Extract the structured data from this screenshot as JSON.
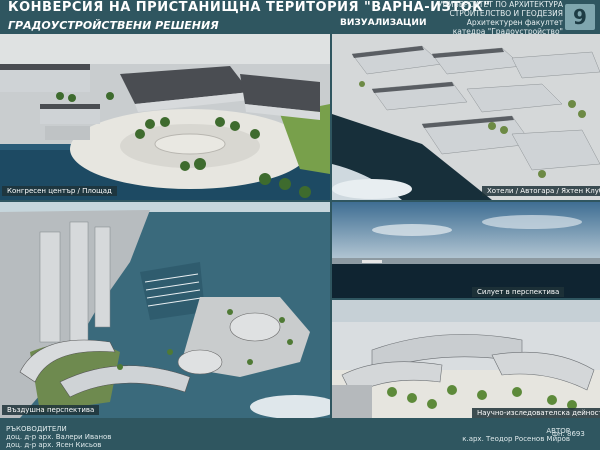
{
  "header": {
    "title": "КОНВЕРСИЯ НА ПРИСТАНИЩНА ТЕРИТОРИЯ \"ВАРНА-ИЗТОК\"",
    "subtitle": "ГРАДОУСТРОЙСТВЕНИ РЕШЕНИЯ",
    "viz_label": "ВИЗУАЛИЗАЦИИ",
    "university_lines": [
      "УНИВЕРСИТЕТ ПО АРХИТЕКТУРА",
      "СТРОИТЕЛСТВО И ГЕОДЕЗИЯ",
      "Архитектурен факултет",
      "катедра \"Градоустройство\""
    ],
    "page_number": "9"
  },
  "panels": {
    "congress": "Конгресен център / Площад",
    "hotels": "Хотели / Автогара / Яхтен Клуб",
    "aerial": "Въздушна перспектива",
    "silhouette": "Силует в перспектива",
    "research": "Научно-изследователска дейност"
  },
  "footer": {
    "left_lines": [
      "РЪКОВОДИТЕЛИ",
      "доц. д-р арх. Валери Иванов",
      "доц. д-р арх. Ясен Кисьов"
    ],
    "right_lines": [
      "АВТОР",
      "к.арх. Теодор Росенов Миров"
    ],
    "fn": "фн. 8693"
  },
  "colors": {
    "background": "#2f5660",
    "water": "#1d4a63",
    "sky": "#5f8aa8",
    "plaza": "#e7e6e0",
    "grass": "#78a04b",
    "building": "#cfd3d6",
    "roof": "#4a4d52"
  }
}
